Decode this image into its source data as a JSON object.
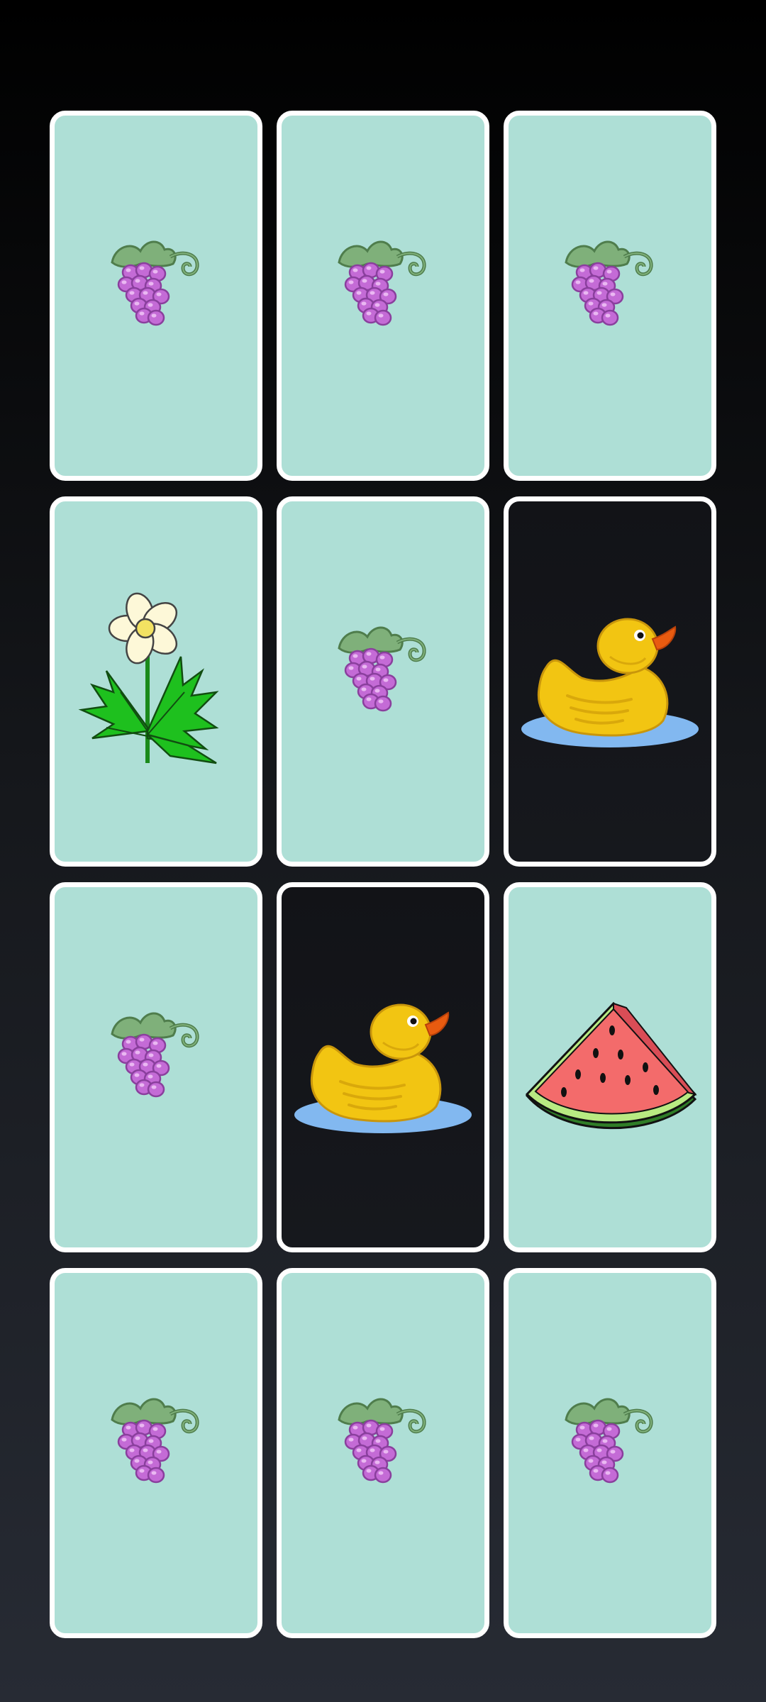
{
  "board": {
    "columns": 3,
    "rows": 4,
    "card_back_color": "#aedfd6",
    "card_face_color": "#16181d",
    "cards": [
      {
        "state": "face-down",
        "icon": "grapes-icon"
      },
      {
        "state": "face-down",
        "icon": "grapes-icon"
      },
      {
        "state": "face-down",
        "icon": "grapes-icon"
      },
      {
        "state": "face-down",
        "icon": "flower-icon"
      },
      {
        "state": "face-down",
        "icon": "grapes-icon"
      },
      {
        "state": "face-up",
        "icon": "rubber-duck-icon"
      },
      {
        "state": "face-down",
        "icon": "grapes-icon"
      },
      {
        "state": "face-up",
        "icon": "rubber-duck-icon"
      },
      {
        "state": "face-down",
        "icon": "watermelon-icon"
      },
      {
        "state": "face-down",
        "icon": "grapes-icon"
      },
      {
        "state": "face-down",
        "icon": "grapes-icon"
      },
      {
        "state": "face-down",
        "icon": "grapes-icon"
      }
    ]
  }
}
